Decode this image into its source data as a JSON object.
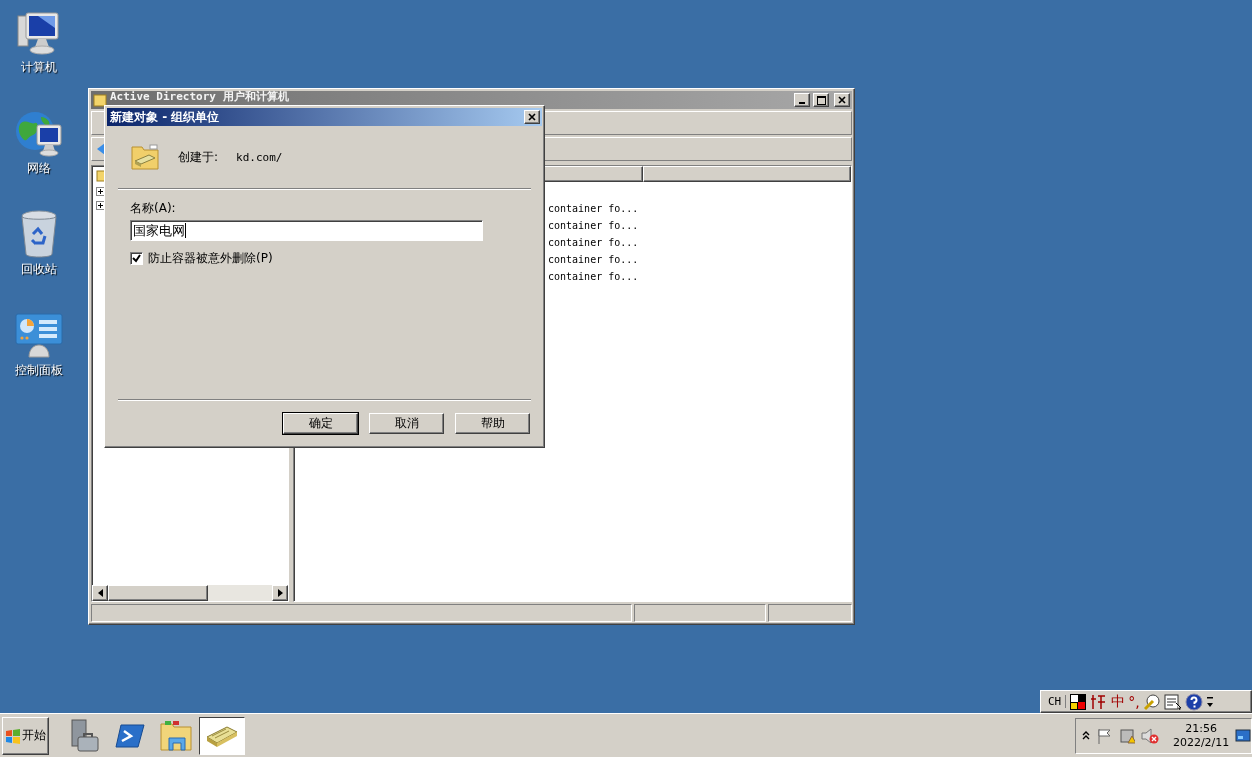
{
  "desktop_icons": [
    {
      "label": "计算机",
      "kind": "computer"
    },
    {
      "label": "网络",
      "kind": "network"
    },
    {
      "label": "回收站",
      "kind": "recycle"
    },
    {
      "label": "控制面板",
      "kind": "control"
    }
  ],
  "explorer_window": {
    "title": "Active Directory 用户和计算机",
    "list_rows": [
      "container fo...",
      "container fo...",
      "container fo...",
      "container fo...",
      "container fo..."
    ]
  },
  "dialog": {
    "title": "新建对象 - 组织单位",
    "created_in_label": "创建于:",
    "created_in_value": "kd.com/",
    "name_label": "名称(A):",
    "name_value": "国家电网",
    "protect": {
      "label": "防止容器被意外删除(P)",
      "checked": true
    },
    "buttons": [
      {
        "label": "确定",
        "default": true
      },
      {
        "label": "取消",
        "default": false
      },
      {
        "label": "帮助",
        "default": false
      }
    ]
  },
  "language_bar": {
    "language": "CH",
    "ime_mode": "中",
    "punctuation": "°,"
  },
  "taskbar": {
    "start_label": "开始",
    "apps": [
      {
        "kind": "server",
        "selected": false
      },
      {
        "kind": "shell",
        "selected": false
      },
      {
        "kind": "folder",
        "selected": false
      },
      {
        "kind": "directory",
        "selected": true
      }
    ],
    "clock": {
      "time": "21:56",
      "date": "2022/2/11"
    }
  }
}
